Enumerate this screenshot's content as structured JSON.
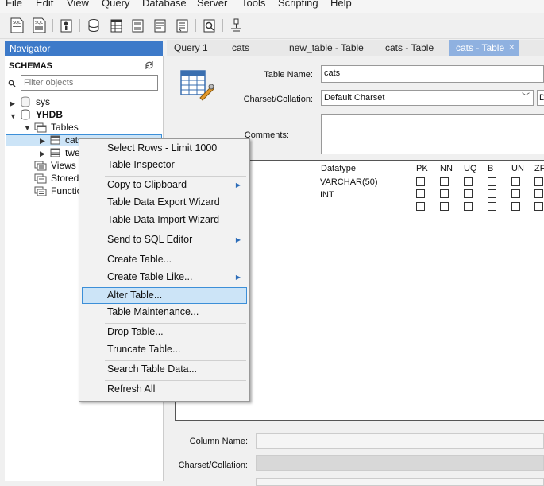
{
  "menubar": {
    "items": [
      "File",
      "Edit",
      "View",
      "Query",
      "Database",
      "Server",
      "Tools",
      "Scripting",
      "Help"
    ]
  },
  "toolbar": {
    "icons": [
      "new-sql-tab-icon",
      "open-sql-script-icon",
      "object-inspector-icon",
      "create-schema-icon",
      "create-table-icon",
      "create-view-icon",
      "create-procedure-icon",
      "create-function-icon",
      "search-table-data-icon",
      "reconnect-icon"
    ],
    "sql_badge": "SQL"
  },
  "navigator": {
    "title": "Navigator",
    "schemas_label": "SCHEMAS",
    "filter_placeholder": "Filter objects",
    "tree": {
      "sys": "sys",
      "yhdb": "YHDB",
      "tables": "Tables",
      "cats": "cats",
      "tweets": "twe",
      "views": "Views",
      "stored": "Stored",
      "functions": "Functio"
    }
  },
  "tabs": [
    "Query 1",
    "cats",
    "new_table - Table",
    "cats - Table",
    "cats - Table"
  ],
  "editor": {
    "table_name_label": "Table Name:",
    "table_name_value": "cats",
    "charset_label": "Charset/Collation:",
    "charset_value": "Default Charset",
    "charset_extra": "D",
    "comments_label": "Comments:",
    "columns_header": {
      "datatype": "Datatype",
      "pk": "PK",
      "nn": "NN",
      "uq": "UQ",
      "b": "B",
      "un": "UN",
      "zf": "ZF"
    },
    "rows": [
      {
        "datatype": "VARCHAR(50)"
      },
      {
        "datatype": "INT"
      },
      {
        "datatype": ""
      }
    ],
    "column_name_label": "Column Name:",
    "column_charset_label": "Charset/Collation:"
  },
  "context_menu": {
    "items": [
      {
        "label": "Select Rows - Limit 1000"
      },
      {
        "label": "Table Inspector"
      },
      {
        "label": "Copy to Clipboard"
      },
      {
        "label": "Table Data Export Wizard"
      },
      {
        "label": "Table Data Import Wizard"
      },
      {
        "label": "Send to SQL Editor"
      },
      {
        "label": "Create Table..."
      },
      {
        "label": "Create Table Like..."
      },
      {
        "label": "Alter Table..."
      },
      {
        "label": "Table Maintenance..."
      },
      {
        "label": "Drop Table..."
      },
      {
        "label": "Truncate Table..."
      },
      {
        "label": "Search Table Data..."
      },
      {
        "label": "Refresh All"
      }
    ],
    "highlighted": "Alter Table..."
  },
  "colors": {
    "nav_header": "#3d7ac9",
    "selection": "#cce4f7",
    "selection_border": "#3c8fd8",
    "active_tab": "#8fb1e0",
    "submenu_arrow": "#2a6bb8"
  }
}
